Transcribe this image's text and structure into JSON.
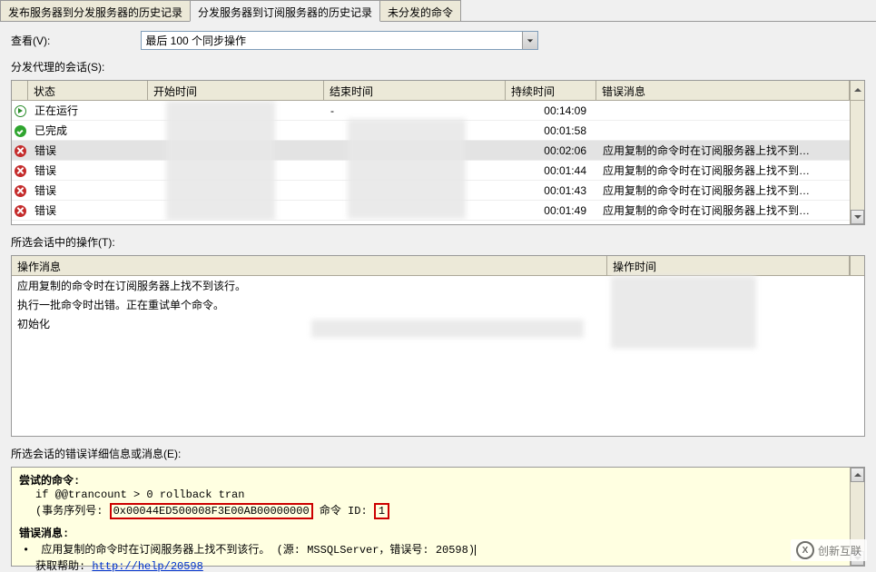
{
  "tabs": {
    "tab1": "发布服务器到分发服务器的历史记录",
    "tab2": "分发服务器到订阅服务器的历史记录",
    "tab3": "未分发的命令"
  },
  "view": {
    "label": "查看(V):",
    "selected": "最后 100 个同步操作"
  },
  "sessions": {
    "label": "分发代理的会话(S):",
    "headers": {
      "status": "状态",
      "start": "开始时间",
      "end": "结束时间",
      "duration": "持续时间",
      "error": "错误消息"
    },
    "rows": [
      {
        "icon": "play",
        "status": "正在运行",
        "start": "",
        "end": "-",
        "duration": "00:14:09",
        "error": ""
      },
      {
        "icon": "check",
        "status": "已完成",
        "start": "",
        "end": "",
        "duration": "00:01:58",
        "error": ""
      },
      {
        "icon": "err",
        "status": "错误",
        "start": "",
        "end": "",
        "duration": "00:02:06",
        "error": "应用复制的命令时在订阅服务器上找不到…",
        "selected": true
      },
      {
        "icon": "err",
        "status": "错误",
        "start": "",
        "end": "",
        "duration": "00:01:44",
        "error": "应用复制的命令时在订阅服务器上找不到…"
      },
      {
        "icon": "err",
        "status": "错误",
        "start": "",
        "end": "",
        "duration": "00:01:43",
        "error": "应用复制的命令时在订阅服务器上找不到…"
      },
      {
        "icon": "err",
        "status": "错误",
        "start": "",
        "end": "",
        "duration": "00:01:49",
        "error": "应用复制的命令时在订阅服务器上找不到…"
      }
    ]
  },
  "operations": {
    "label": "所选会话中的操作(T):",
    "headers": {
      "msg": "操作消息",
      "time": "操作时间"
    },
    "rows": [
      {
        "msg": "应用复制的命令时在订阅服务器上找不到该行。",
        "time": ""
      },
      {
        "msg": "执行一批命令时出错。正在重试单个命令。",
        "time": ""
      },
      {
        "msg": "初始化",
        "time": ""
      }
    ]
  },
  "details": {
    "label": "所选会话的错误详细信息或消息(E):",
    "attempted_cmd_label": "尝试的命令:",
    "cmd_line": "if @@trancount > 0 rollback tran",
    "seq_label": "(事务序列号: ",
    "seq_value": "0x00044ED500008F3E00AB00000000",
    "cmd_id_label": " 命令 ID: ",
    "cmd_id_value": "1",
    "error_msg_label": "错误消息:",
    "err_text": "应用复制的命令时在订阅服务器上找不到该行。 (源: MSSQLServer，错误号: 20598)",
    "help_label": "获取帮助: ",
    "help_link": "http://help/20598"
  },
  "watermark": {
    "logo": "X",
    "text": "创新互联"
  }
}
